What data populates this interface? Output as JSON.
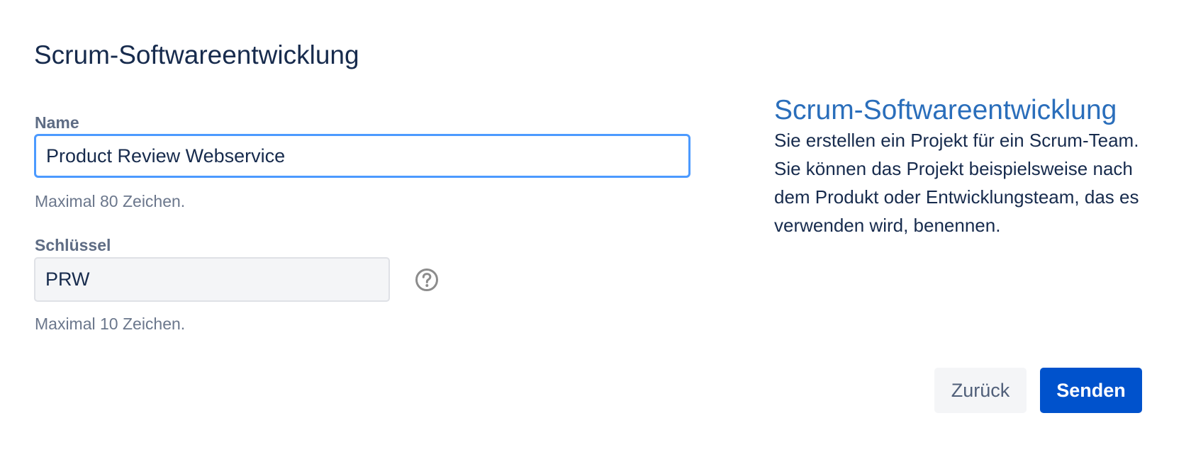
{
  "dialog": {
    "title": "Scrum-Softwareentwicklung"
  },
  "form": {
    "name": {
      "label": "Name",
      "value": "Product Review Webservice",
      "hint": "Maximal 80 Zeichen."
    },
    "key": {
      "label": "Schlüssel",
      "value": "PRW",
      "hint": "Maximal 10 Zeichen.",
      "help_icon": "question-circle-icon"
    }
  },
  "description": {
    "title": "Scrum-Softwareentwicklung",
    "text": "Sie erstellen ein Projekt für ein Scrum-Team. Sie können das Projekt beispielsweise nach dem Produkt oder Entwicklungsteam, das es verwenden wird, benennen."
  },
  "actions": {
    "back_label": "Zurück",
    "submit_label": "Senden"
  },
  "colors": {
    "title": "#172b4d",
    "accent_link": "#2a6ebb",
    "primary_button": "#0052cc",
    "focus_border": "#4c9aff",
    "label": "#5e6c84"
  }
}
